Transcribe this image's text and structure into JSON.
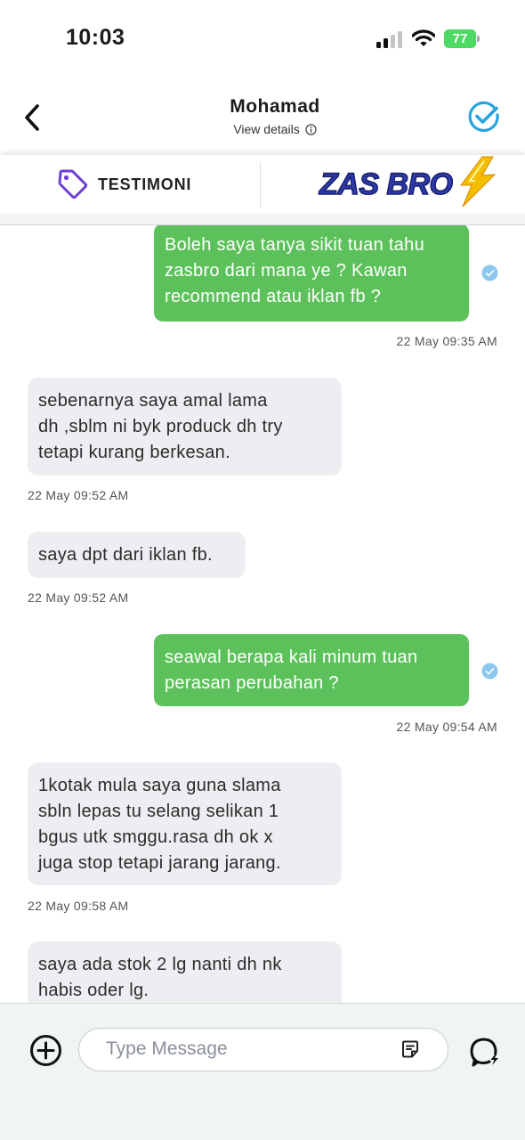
{
  "status_bar": {
    "time": "10:03",
    "battery_percent": "77",
    "battery_color": "#4cd964",
    "icons": [
      "signal-icon",
      "wifi-icon",
      "battery-icon"
    ]
  },
  "header": {
    "name": "Mohamad",
    "subtitle": "View details",
    "icons": [
      "back-chevron-icon",
      "info-icon",
      "verified-check-icon"
    ],
    "accent": "#29a3e0"
  },
  "banner": {
    "testimoni_label": "TESTIMONI",
    "brand_logo_text": "ZAS BRO",
    "icons": [
      "tag-icon",
      "lightning-bolt-icon"
    ],
    "tag_color": "#6c3fd6"
  },
  "messages": [
    {
      "direction": "outgoing",
      "text_lines": [
        "Boleh saya tanya sikit tuan tahu",
        "zasbro dari mana ye ? Kawan",
        "recommend atau iklan fb ?"
      ],
      "time": "22 May 09:35 AM",
      "read": true
    },
    {
      "direction": "incoming",
      "text_lines": [
        "sebenarnya saya amal lama",
        "dh ,sblm ni byk produck dh try",
        "tetapi kurang berkesan."
      ],
      "time": "22 May 09:52 AM"
    },
    {
      "direction": "incoming",
      "text_lines": [
        "saya dpt dari iklan fb."
      ],
      "time": "22 May 09:52 AM"
    },
    {
      "direction": "outgoing",
      "text_lines": [
        "seawal berapa kali minum tuan",
        "perasan perubahan ?"
      ],
      "time": "22 May 09:54 AM",
      "read": true
    },
    {
      "direction": "incoming",
      "text_lines": [
        "1kotak mula saya guna slama",
        "sbln lepas tu selang selikan 1",
        "bgus utk smggu.rasa dh ok x",
        "juga stop tetapi jarang jarang."
      ],
      "time": "22 May 09:58 AM"
    },
    {
      "direction": "incoming",
      "text_lines": [
        "saya ada stok 2 lg nanti dh nk",
        "habis oder lg."
      ],
      "time": ""
    }
  ],
  "colors": {
    "outgoing_bubble": "#5cc15a",
    "incoming_bubble": "#eeeef2",
    "read_check": "#8cc8ee"
  },
  "composer": {
    "placeholder": "Type Message",
    "value": "",
    "icons": [
      "add-circle-icon",
      "template-note-icon",
      "quick-reply-icon"
    ]
  }
}
